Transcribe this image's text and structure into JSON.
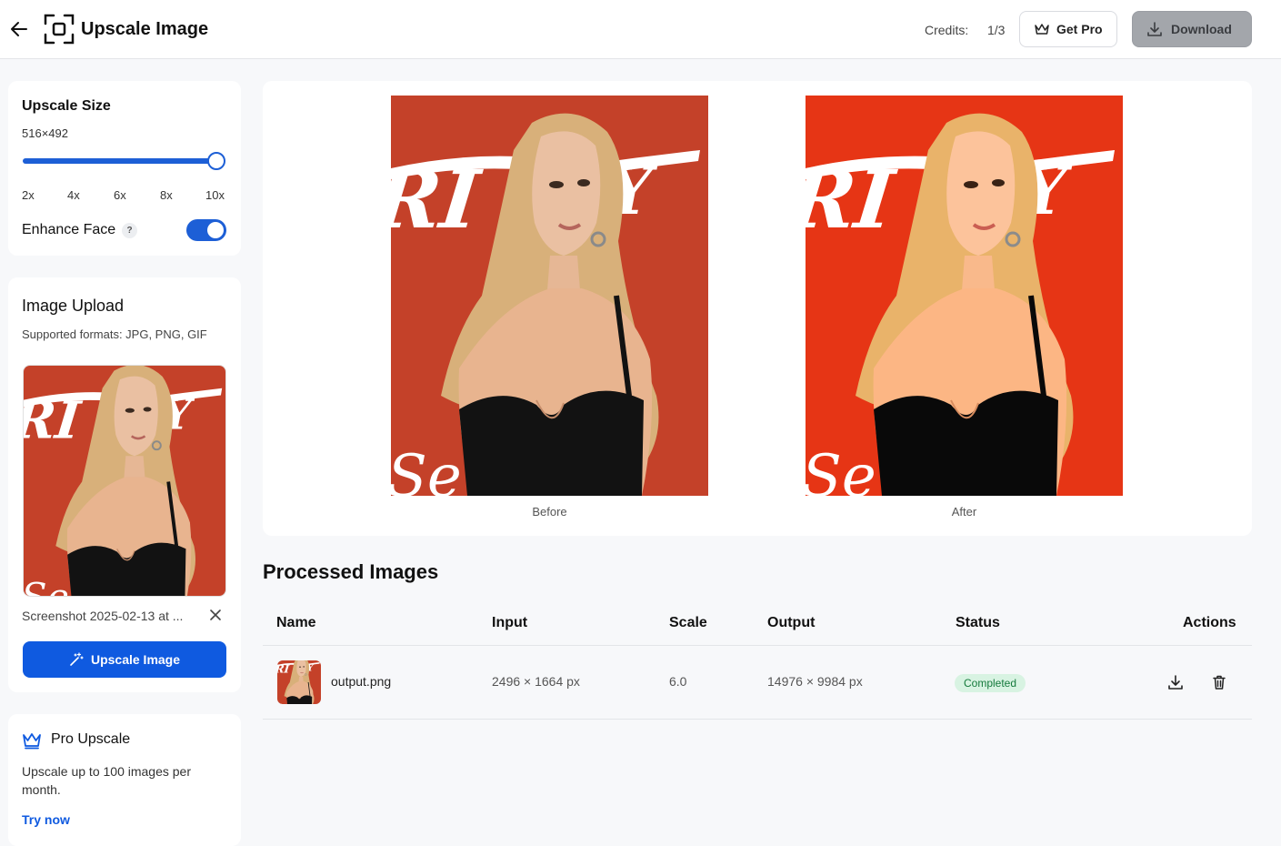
{
  "header": {
    "title": "Upscale Image",
    "credits_label": "Credits:",
    "credits_value": "1/3",
    "get_pro_label": "Get Pro",
    "download_label": "Download"
  },
  "upscale_size": {
    "title": "Upscale Size",
    "value": "516×492",
    "slider_level": 1.0,
    "ticks": [
      "2x",
      "4x",
      "6x",
      "8x",
      "10x"
    ],
    "enhance_face_label": "Enhance Face",
    "enhance_face_help": "?",
    "enhance_face_on": true
  },
  "upload": {
    "title": "Image Upload",
    "subtitle": "Supported formats: JPG, PNG, GIF",
    "file_name": "Screenshot 2025-02-13 at ...",
    "upscale_button": "Upscale Image"
  },
  "pro": {
    "title": "Pro Upscale",
    "description": "Upscale up to 100 images per month.",
    "link": "Try now"
  },
  "compare": {
    "before_label": "Before",
    "after_label": "After"
  },
  "processed": {
    "title": "Processed Images",
    "columns": [
      "Name",
      "Input",
      "Scale",
      "Output",
      "Status",
      "Actions"
    ],
    "rows": [
      {
        "name": "output.png",
        "input": "2496 × 1664 px",
        "scale": "6.0",
        "output": "14976 × 9984 px",
        "status": "Completed"
      }
    ]
  },
  "colors": {
    "accent": "#0f5ae0",
    "slider": "#1d5fd6",
    "status_bg": "#d8f3e2",
    "status_text": "#157a3c",
    "photo_background": "#c8442b"
  },
  "icons": {
    "back": "arrow-left-icon",
    "logo": "scan-frame-icon",
    "get_pro": "crown-icon",
    "download": "download-icon",
    "remove": "close-icon",
    "upscale": "magic-wand-icon",
    "pro": "crown-icon",
    "row_download": "download-icon",
    "row_delete": "trash-icon"
  }
}
